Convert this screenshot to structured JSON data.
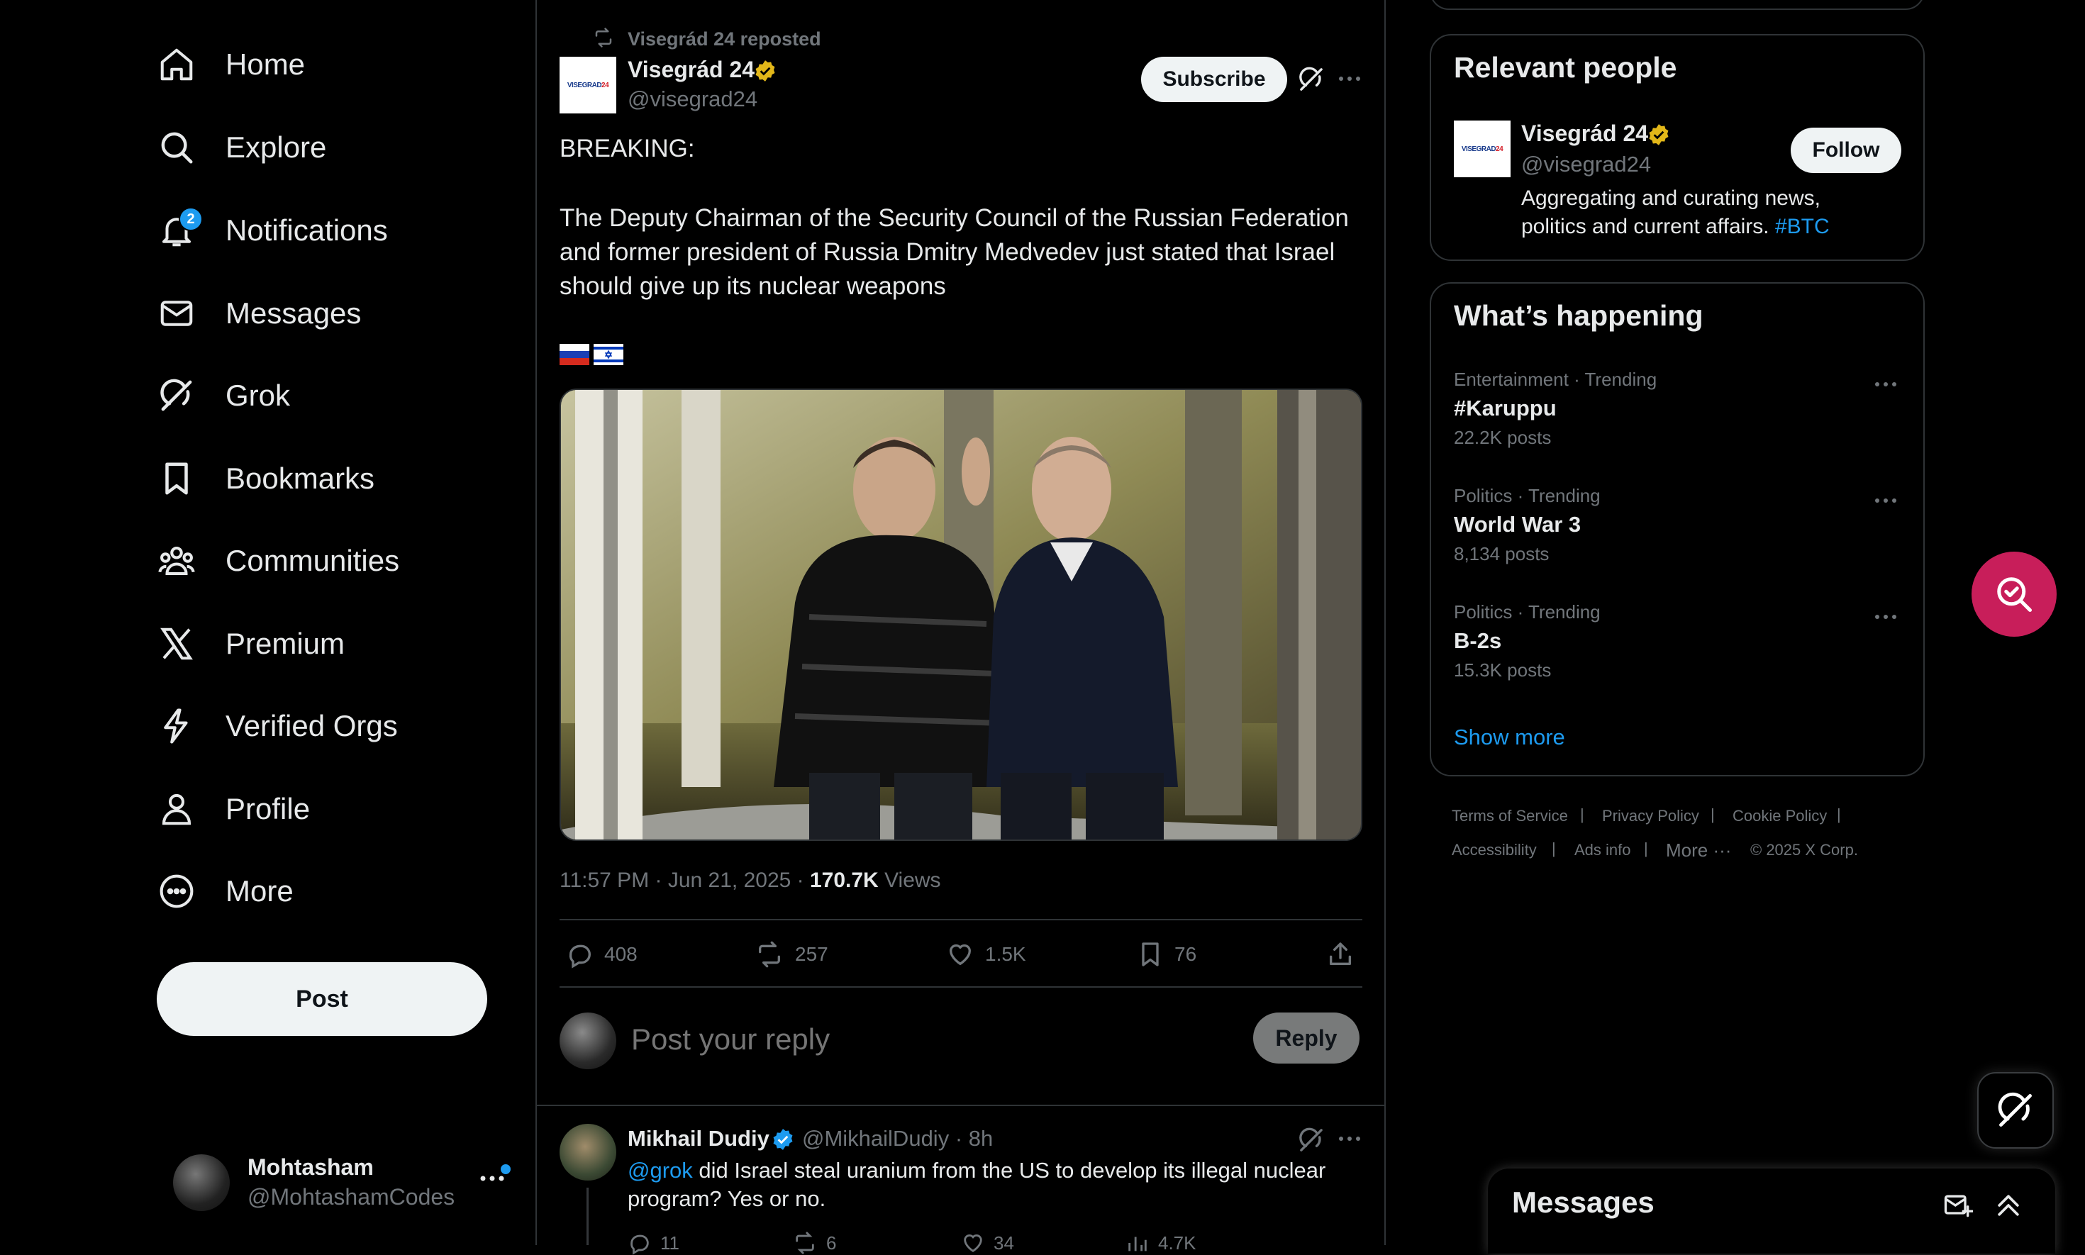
{
  "nav": {
    "items": [
      {
        "label": "Home",
        "icon": "home-icon"
      },
      {
        "label": "Explore",
        "icon": "search-icon"
      },
      {
        "label": "Notifications",
        "icon": "bell-icon",
        "badge": "2"
      },
      {
        "label": "Messages",
        "icon": "envelope-icon"
      },
      {
        "label": "Grok",
        "icon": "grok-icon"
      },
      {
        "label": "Bookmarks",
        "icon": "bookmark-icon"
      },
      {
        "label": "Communities",
        "icon": "communities-icon"
      },
      {
        "label": "Premium",
        "icon": "x-logo-icon"
      },
      {
        "label": "Verified Orgs",
        "icon": "lightning-icon"
      },
      {
        "label": "Profile",
        "icon": "person-icon"
      },
      {
        "label": "More",
        "icon": "more-circle-icon"
      }
    ],
    "post_button": "Post"
  },
  "account": {
    "name": "Mohtasham",
    "handle": "@MohtashamCodes"
  },
  "post": {
    "repost_text": "Visegrád 24 reposted",
    "author_name": "Visegrád 24",
    "author_handle": "@visegrad24",
    "logo_text_a": "VISEGRAD",
    "logo_text_b": "24",
    "subscribe_label": "Subscribe",
    "body_line1": "BREAKING:",
    "body_para": "The Deputy Chairman of the Security Council of the Russian Federation and former president of Russia Dmitry Medvedev just stated that Israel should give up its nuclear weapons",
    "flags": [
      "russia-flag",
      "israel-flag"
    ],
    "timestamp": "11:57 PM · Jun 21, 2025 · ",
    "views_count": "170.7K",
    "views_label": "Views",
    "stats": {
      "replies": "408",
      "reposts": "257",
      "likes": "1.5K",
      "bookmarks": "76"
    }
  },
  "reply_box": {
    "placeholder": "Post your reply",
    "button": "Reply"
  },
  "comment": {
    "name": "Mikhail Dudiy",
    "handle": "@MikhailDudiy",
    "time": "· 8h",
    "mention": "@grok",
    "text_line1": " did Israel steal uranium from the US to develop its illegal nuclear",
    "text_line2": "program? Yes or no.",
    "stats": {
      "replies": "11",
      "reposts": "6",
      "likes": "34",
      "views": "4.7K"
    }
  },
  "relevant": {
    "title": "Relevant people",
    "name": "Visegrád 24",
    "handle": "@visegrad24",
    "follow": "Follow",
    "bio_line1": "Aggregating and curating news,",
    "bio_line2": "politics and current affairs. ",
    "bio_tag": "#BTC"
  },
  "happening": {
    "title": "What’s happening",
    "trends": [
      {
        "context": "Entertainment · Trending",
        "topic": "#Karuppu",
        "posts": "22.2K posts"
      },
      {
        "context": "Politics · Trending",
        "topic": "World War 3",
        "posts": "8,134 posts"
      },
      {
        "context": "Politics · Trending",
        "topic": "B-2s",
        "posts": "15.3K posts"
      }
    ],
    "show_more": "Show more"
  },
  "footer": {
    "links": [
      "Terms of Service",
      "Privacy Policy",
      "Cookie Policy",
      "Accessibility",
      "Ads info",
      "More ···"
    ],
    "copyright": "© 2025 X Corp."
  },
  "messages_drawer": {
    "title": "Messages"
  },
  "colors": {
    "accent": "#1d9bf0",
    "verified_gold": "#e2b719",
    "fab_pink": "#c81e5a",
    "background": "#000000"
  }
}
